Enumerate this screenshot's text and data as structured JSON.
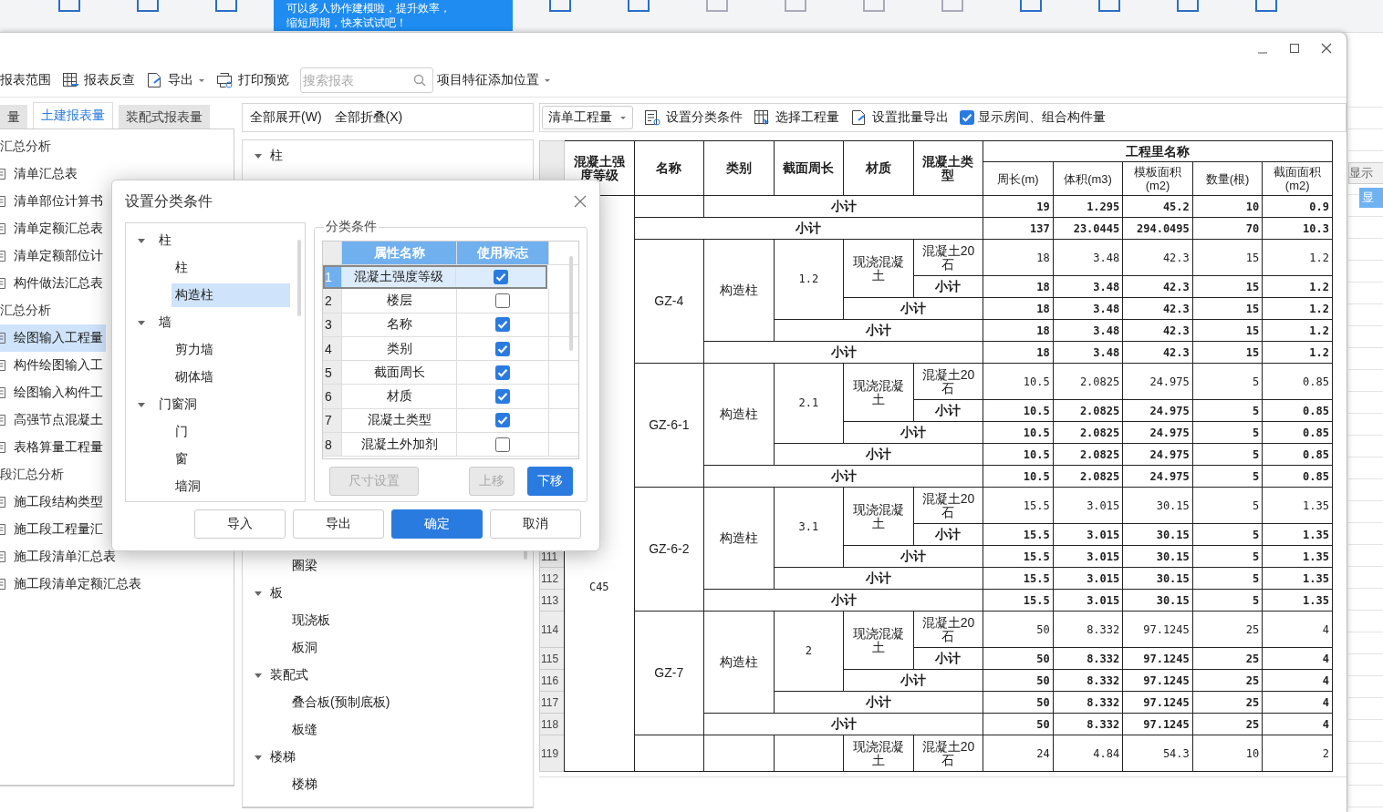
{
  "background_app": {
    "banner": [
      "可以多人协作建模啦，提升效率，",
      "缩短周期，快来试试吧！"
    ],
    "side_tab": "显示",
    "side_header": "显"
  },
  "toolbar": {
    "items": [
      {
        "label": "报表范围",
        "kind": "text"
      },
      {
        "label": "报表反查",
        "kind": "grid"
      },
      {
        "label": "导出",
        "kind": "export"
      },
      {
        "label": "打印预览",
        "kind": "print"
      }
    ],
    "search": {
      "placeholder": "搜索报表"
    },
    "feature_position": "项目特征添加位置"
  },
  "left_panel": {
    "tabs": [
      {
        "label": "量",
        "selected": false
      },
      {
        "label": "土建报表量",
        "selected": true
      },
      {
        "label": "装配式报表量",
        "selected": false
      }
    ],
    "items": [
      {
        "label": "汇总分析",
        "kind": "section",
        "selected": false
      },
      {
        "label": "清单汇总表",
        "kind": "report",
        "selected": false
      },
      {
        "label": "清单部位计算书",
        "kind": "report",
        "selected": false
      },
      {
        "label": "清单定额汇总表",
        "kind": "report",
        "selected": false
      },
      {
        "label": "清单定额部位计",
        "kind": "report",
        "selected": false
      },
      {
        "label": "构件做法汇总表",
        "kind": "report",
        "selected": false
      },
      {
        "label": "汇总分析",
        "kind": "section",
        "selected": false
      },
      {
        "label": "绘图输入工程量",
        "kind": "report",
        "selected": true
      },
      {
        "label": "构件绘图输入工",
        "kind": "report",
        "selected": false
      },
      {
        "label": "绘图输入构件工",
        "kind": "report",
        "selected": false
      },
      {
        "label": "高强节点混凝土",
        "kind": "report",
        "selected": false
      },
      {
        "label": "表格算量工程量",
        "kind": "report",
        "selected": false
      },
      {
        "label": "段汇总分析",
        "kind": "section",
        "selected": false
      },
      {
        "label": "施工段结构类型",
        "kind": "report",
        "selected": false
      },
      {
        "label": "施工段工程量汇",
        "kind": "report",
        "selected": false
      },
      {
        "label": "施工段清单汇总表",
        "kind": "report",
        "selected": false
      },
      {
        "label": "施工段清单定额汇总表",
        "kind": "report",
        "selected": false
      }
    ]
  },
  "middle_panel": {
    "actions": [
      "全部展开(W)",
      "全部折叠(X)"
    ],
    "tree": [
      {
        "label": "柱",
        "expanded": true
      },
      {
        "label": "圈梁"
      },
      {
        "label": "板",
        "expanded": true,
        "children": [
          {
            "label": "现浇板"
          },
          {
            "label": "板洞"
          }
        ]
      },
      {
        "label": "装配式",
        "expanded": true,
        "children": [
          {
            "label": "叠合板(预制底板)"
          },
          {
            "label": "板缝"
          }
        ]
      },
      {
        "label": "楼梯",
        "expanded": true,
        "children": [
          {
            "label": "楼梯"
          }
        ]
      }
    ]
  },
  "report_toolbar": {
    "dropdown": "清单工程量",
    "actions": [
      {
        "label": "设置分类条件",
        "kind": "classify"
      },
      {
        "label": "选择工程量",
        "kind": "select"
      },
      {
        "label": "设置批量导出",
        "kind": "export"
      }
    ],
    "show_rooms": {
      "label": "显示房间、组合构件量",
      "checked": true
    }
  },
  "table": {
    "columns": [
      "混凝土强度等级",
      "名称",
      "类别",
      "截面周长",
      "材质",
      "混凝土类型"
    ],
    "quantity_header": "工程里名称",
    "quantity_columns": [
      "周长(m)",
      "体积(m3)",
      "模板面积(m2)",
      "数量(根)",
      "截面面积(m2)"
    ],
    "grade": "C45",
    "leading_rows": [
      {
        "kind": "category_total",
        "label": "小计",
        "values": [
          "19",
          "1.295",
          "45.2",
          "10",
          "0.9"
        ]
      },
      {
        "kind": "name_total",
        "label": "小计",
        "values": [
          "137",
          "23.0445",
          "294.0495",
          "70",
          "10.3"
        ]
      }
    ],
    "groups": [
      {
        "name": "GZ-4",
        "category": "构造柱",
        "perimeter": "1.2",
        "material": "现浇混凝土",
        "concrete_type": "混凝土20石",
        "values": [
          "18",
          "3.48",
          "42.3",
          "15",
          "1.2"
        ],
        "subtotals": [
          {
            "kind": "type_total",
            "label": "小计",
            "values": [
              "18",
              "3.48",
              "42.3",
              "15",
              "1.2"
            ]
          },
          {
            "kind": "material_total",
            "label": "小计",
            "values": [
              "18",
              "3.48",
              "42.3",
              "15",
              "1.2"
            ]
          },
          {
            "kind": "perimeter_total",
            "label": "小计",
            "values": [
              "18",
              "3.48",
              "42.3",
              "15",
              "1.2"
            ]
          },
          {
            "kind": "category_total",
            "label": "小计",
            "values": [
              "18",
              "3.48",
              "42.3",
              "15",
              "1.2"
            ]
          }
        ]
      },
      {
        "name": "GZ-6-1",
        "category": "构造柱",
        "perimeter": "2.1",
        "material": "现浇混凝土",
        "concrete_type": "混凝土20石",
        "values": [
          "10.5",
          "2.0825",
          "24.975",
          "5",
          "0.85"
        ],
        "subtotals": [
          {
            "kind": "type_total",
            "label": "小计",
            "values": [
              "10.5",
              "2.0825",
              "24.975",
              "5",
              "0.85"
            ]
          },
          {
            "kind": "material_total",
            "label": "小计",
            "values": [
              "10.5",
              "2.0825",
              "24.975",
              "5",
              "0.85"
            ]
          },
          {
            "kind": "perimeter_total",
            "label": "小计",
            "values": [
              "10.5",
              "2.0825",
              "24.975",
              "5",
              "0.85"
            ]
          },
          {
            "kind": "category_total",
            "label": "小计",
            "values": [
              "10.5",
              "2.0825",
              "24.975",
              "5",
              "0.85"
            ]
          }
        ]
      },
      {
        "name": "GZ-6-2",
        "category": "构造柱",
        "perimeter": "3.1",
        "material": "现浇混凝土",
        "concrete_type": "混凝土20石",
        "values": [
          "15.5",
          "3.015",
          "30.15",
          "5",
          "1.35"
        ],
        "subtotals": [
          {
            "kind": "type_total",
            "label": "小计",
            "values": [
              "15.5",
              "3.015",
              "30.15",
              "5",
              "1.35"
            ]
          },
          {
            "kind": "material_total",
            "label": "小计",
            "number": "111",
            "values": [
              "15.5",
              "3.015",
              "30.15",
              "5",
              "1.35"
            ]
          },
          {
            "kind": "perimeter_total",
            "label": "小计",
            "number": "112",
            "values": [
              "15.5",
              "3.015",
              "30.15",
              "5",
              "1.35"
            ]
          },
          {
            "kind": "category_total",
            "label": "小计",
            "number": "113",
            "values": [
              "15.5",
              "3.015",
              "30.15",
              "5",
              "1.35"
            ]
          }
        ]
      },
      {
        "name": "GZ-7",
        "category": "构造柱",
        "perimeter": "2",
        "material": "现浇混凝土",
        "concrete_type": "混凝土20石",
        "number": "114",
        "values": [
          "50",
          "8.332",
          "97.1245",
          "25",
          "4"
        ],
        "subtotals": [
          {
            "kind": "type_total",
            "label": "小计",
            "number": "115",
            "values": [
              "50",
              "8.332",
              "97.1245",
              "25",
              "4"
            ]
          },
          {
            "kind": "material_total",
            "label": "小计",
            "number": "116",
            "values": [
              "50",
              "8.332",
              "97.1245",
              "25",
              "4"
            ]
          },
          {
            "kind": "perimeter_total",
            "label": "小计",
            "number": "117",
            "values": [
              "50",
              "8.332",
              "97.1245",
              "25",
              "4"
            ]
          },
          {
            "kind": "category_total",
            "label": "小计",
            "number": "118",
            "values": [
              "50",
              "8.332",
              "97.1245",
              "25",
              "4"
            ]
          }
        ]
      }
    ],
    "last_row": {
      "number": "119",
      "material": "现浇混凝土",
      "concrete_type": "混凝土20石",
      "values": [
        "24",
        "4.84",
        "54.3",
        "10",
        "2"
      ]
    }
  },
  "dialog": {
    "title": "设置分类条件",
    "tree": [
      {
        "label": "柱",
        "expanded": true,
        "selected": false,
        "children": [
          {
            "label": "柱",
            "selected": false
          },
          {
            "label": "构造柱",
            "selected": true
          }
        ]
      },
      {
        "label": "墙",
        "expanded": true,
        "selected": false,
        "children": [
          {
            "label": "剪力墙",
            "selected": false
          },
          {
            "label": "砌体墙",
            "selected": false
          }
        ]
      },
      {
        "label": "门窗洞",
        "expanded": true,
        "selected": false,
        "children": [
          {
            "label": "门",
            "selected": false
          },
          {
            "label": "窗",
            "selected": false
          },
          {
            "label": "墙洞",
            "selected": false
          }
        ]
      }
    ],
    "conditions": {
      "legend": "分类条件",
      "columns": [
        "属性名称",
        "使用标志"
      ],
      "rows": [
        {
          "number": "1",
          "name": "混凝土强度等级",
          "used": true,
          "selected": true
        },
        {
          "number": "2",
          "name": "楼层",
          "used": false,
          "selected": false
        },
        {
          "number": "3",
          "name": "名称",
          "used": true,
          "selected": false
        },
        {
          "number": "4",
          "name": "类别",
          "used": true,
          "selected": false
        },
        {
          "number": "5",
          "name": "截面周长",
          "used": true,
          "selected": false
        },
        {
          "number": "6",
          "name": "材质",
          "used": true,
          "selected": false
        },
        {
          "number": "7",
          "name": "混凝土类型",
          "used": true,
          "selected": false
        },
        {
          "number": "8",
          "name": "混凝土外加剂",
          "used": false,
          "selected": false
        }
      ]
    },
    "side_buttons": [
      {
        "label": "尺寸设置",
        "disabled": true,
        "primary": false
      },
      {
        "label": "上移",
        "disabled": true,
        "primary": false
      },
      {
        "label": "下移",
        "disabled": false,
        "primary": true
      }
    ],
    "buttons": [
      {
        "label": "导入",
        "primary": false
      },
      {
        "label": "导出",
        "primary": false
      },
      {
        "label": "确定",
        "primary": true
      },
      {
        "label": "取消",
        "primary": false
      }
    ]
  }
}
